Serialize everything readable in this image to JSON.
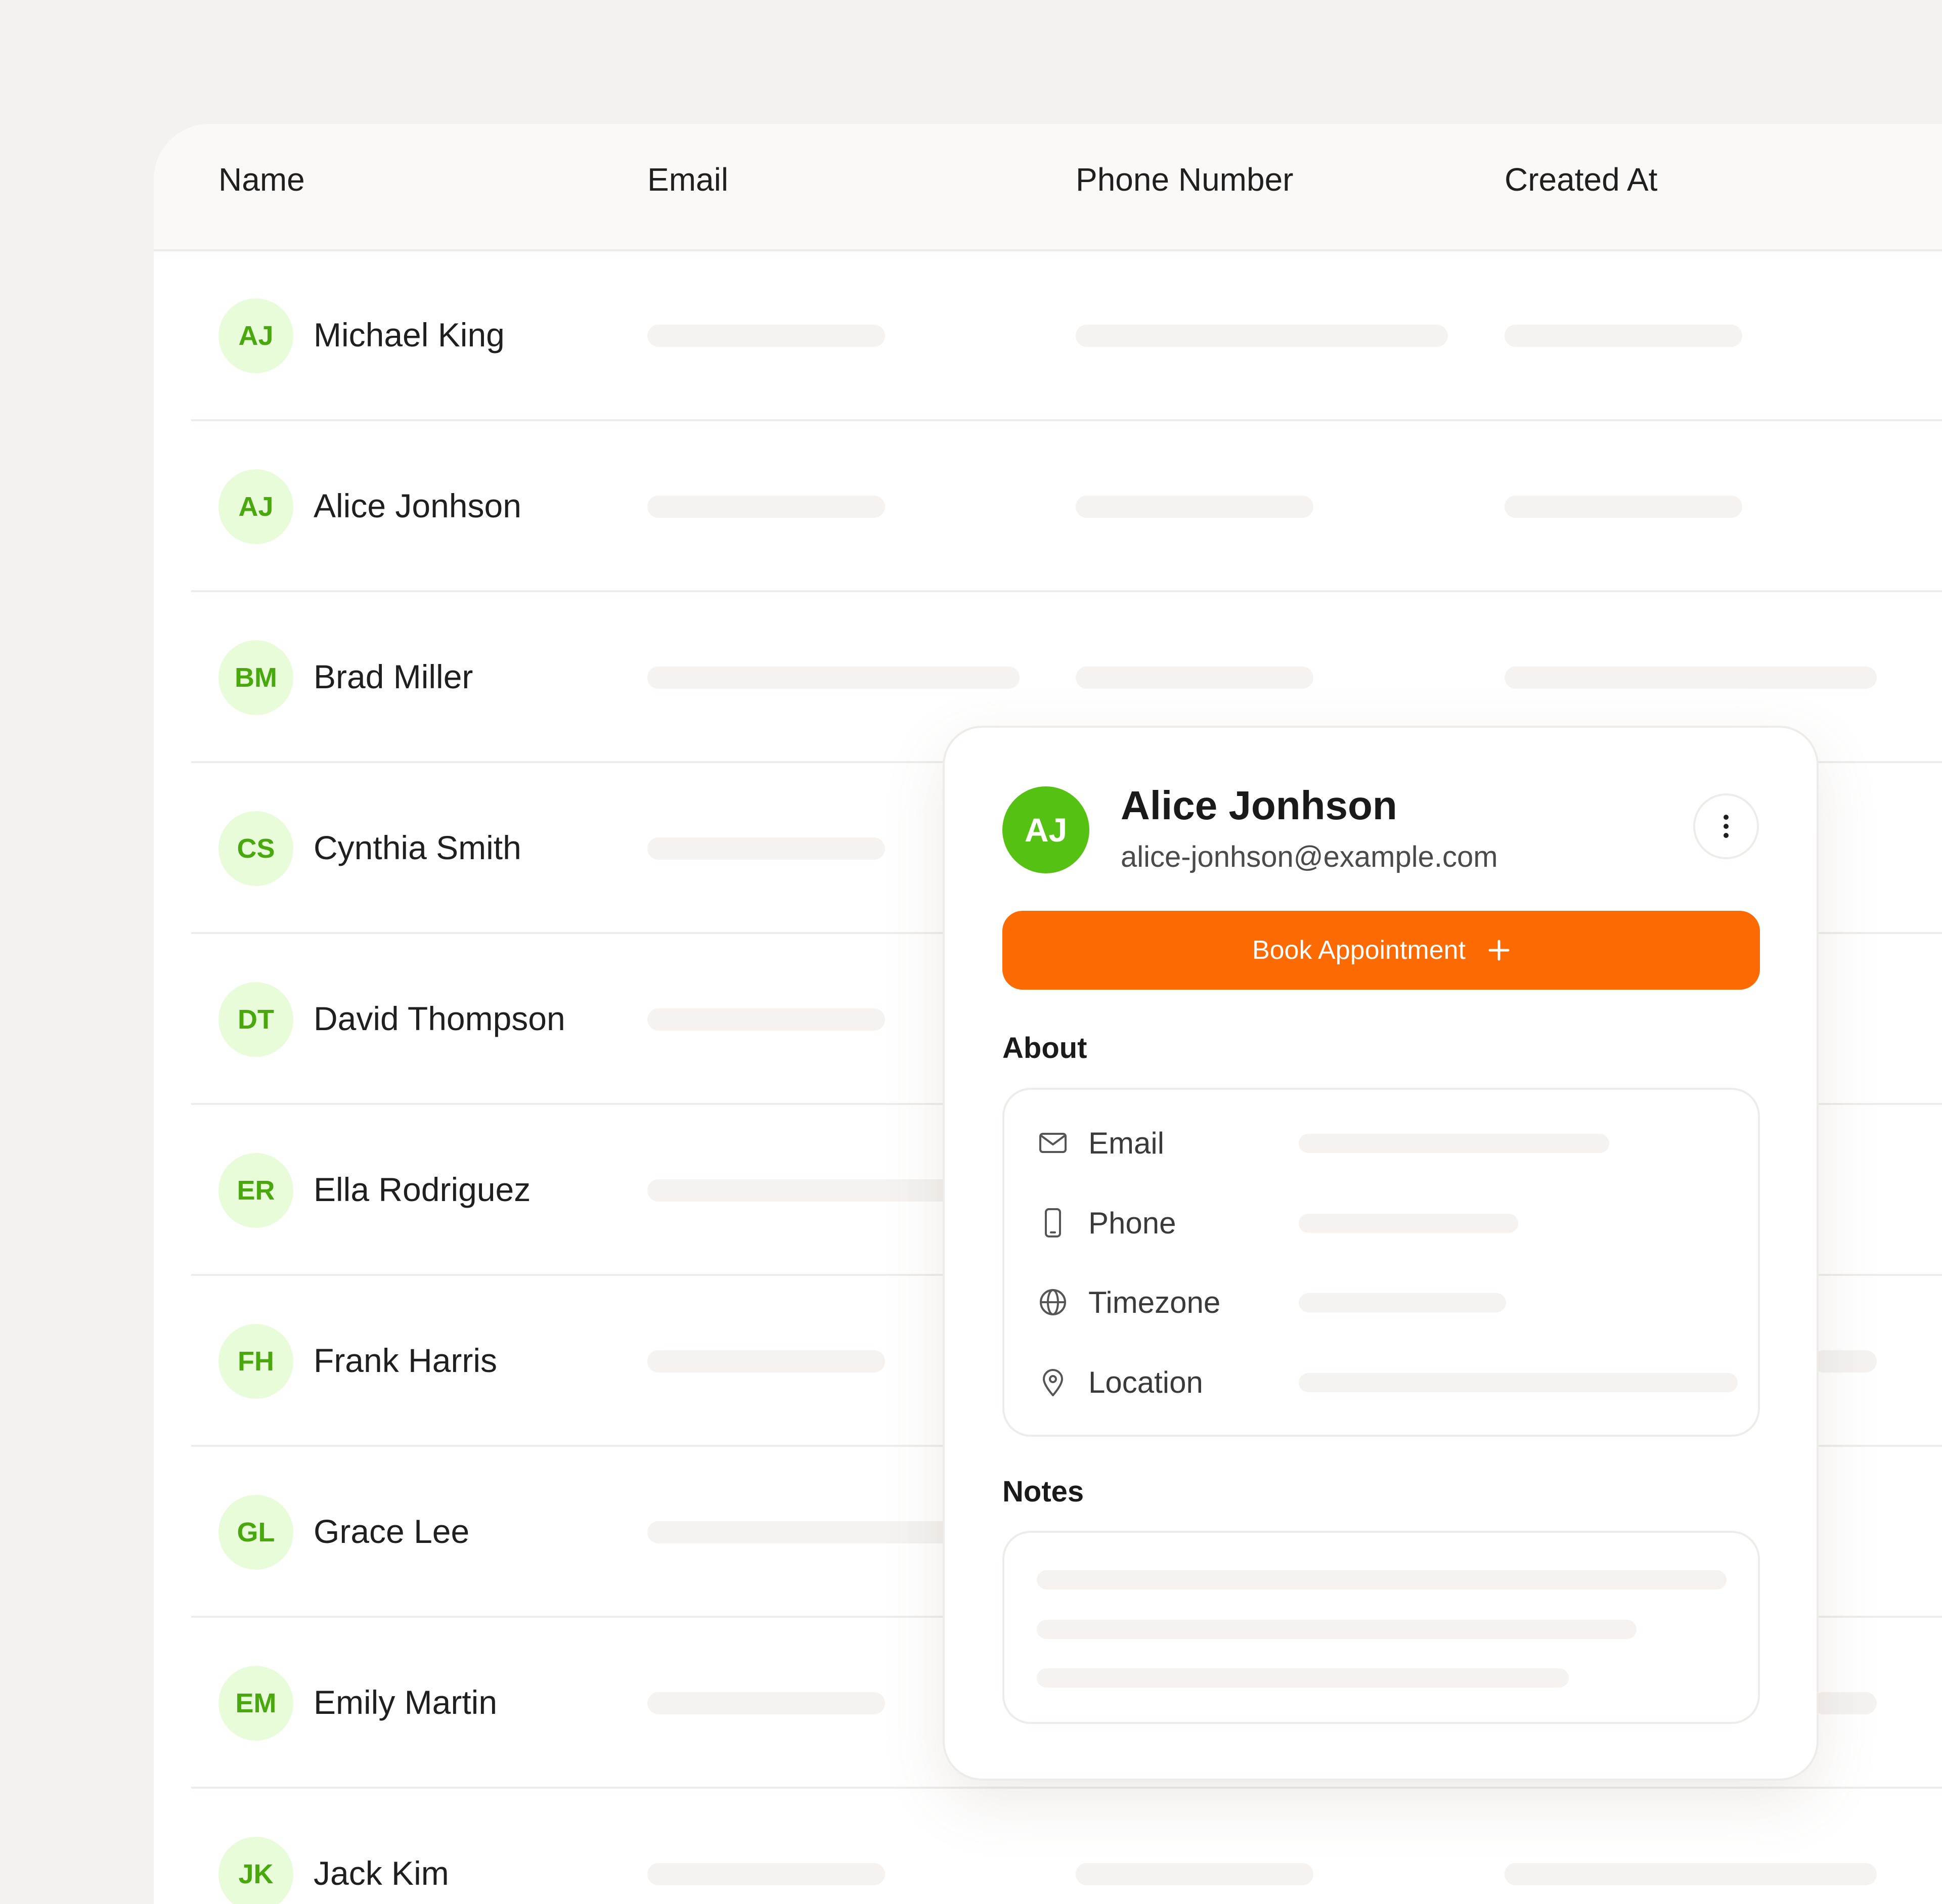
{
  "table": {
    "columns": [
      "Name",
      "Email",
      "Phone Number",
      "Created At"
    ],
    "rows": [
      {
        "initials": "AJ",
        "name": "Michael King"
      },
      {
        "initials": "AJ",
        "name": "Alice Jonhson"
      },
      {
        "initials": "BM",
        "name": "Brad Miller"
      },
      {
        "initials": "CS",
        "name": "Cynthia Smith"
      },
      {
        "initials": "DT",
        "name": "David Thompson"
      },
      {
        "initials": "ER",
        "name": "Ella Rodriguez"
      },
      {
        "initials": "FH",
        "name": "Frank Harris"
      },
      {
        "initials": "GL",
        "name": "Grace Lee"
      },
      {
        "initials": "EM",
        "name": "Emily Martin"
      },
      {
        "initials": "JK",
        "name": "Jack Kim"
      }
    ]
  },
  "card": {
    "initials": "AJ",
    "name": "Alice Jonhson",
    "email": "alice-jonhson@example.com",
    "book_label": "Book Appointment",
    "about_title": "About",
    "about_items": [
      {
        "label": "Email",
        "icon": "mail-icon"
      },
      {
        "label": "Phone",
        "icon": "phone-icon"
      },
      {
        "label": "Timezone",
        "icon": "globe-icon"
      },
      {
        "label": "Location",
        "icon": "location-pin-icon"
      }
    ],
    "notes_title": "Notes"
  },
  "colors": {
    "accent": "#fb6a03",
    "avatar_bg": "#e9fcd9",
    "avatar_text": "#48a80d",
    "avatar_solid": "#55c112",
    "background": "#f5f1ee"
  }
}
